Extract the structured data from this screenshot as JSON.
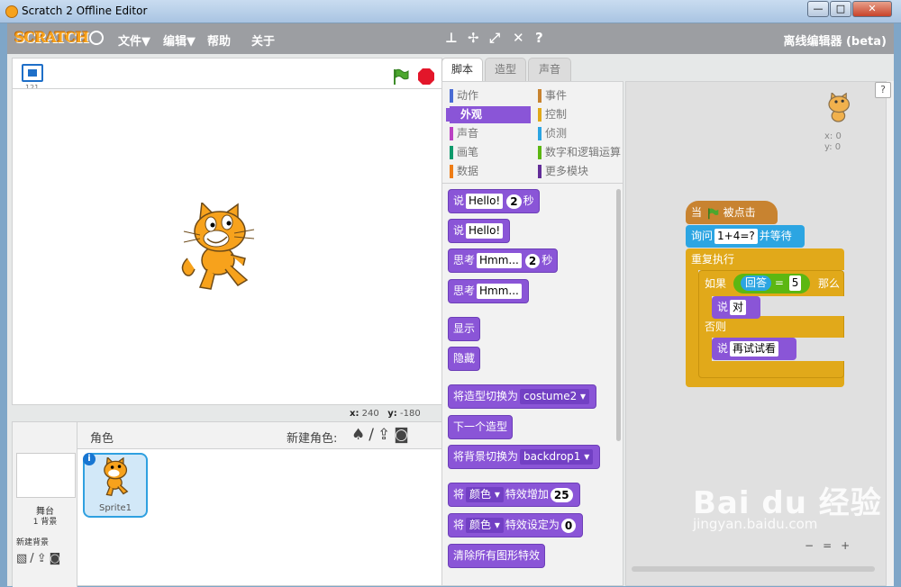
{
  "window": {
    "title": "Scratch 2 Offline Editor",
    "min": "—",
    "max": "□",
    "close": "✕"
  },
  "menu": {
    "logo": "SCRATCH",
    "file": "文件▼",
    "edit": "编辑▼",
    "help": "帮助",
    "about": "关于",
    "offline": "离线编辑器 (beta)"
  },
  "stage": {
    "version": "121",
    "x_label": "x:",
    "x_val": "240",
    "y_label": "y:",
    "y_val": "-180"
  },
  "sprites": {
    "header": "角色",
    "new_sprite": "新建角色:",
    "stage_label": "舞台",
    "backdrops": "1 背景",
    "new_backdrop": "新建背景",
    "sprite_name": "Sprite1"
  },
  "tabs": {
    "scripts": "脚本",
    "costumes": "造型",
    "sounds": "声音"
  },
  "categories": {
    "motion": "动作",
    "looks": "外观",
    "sound": "声音",
    "pen": "画笔",
    "data": "数据",
    "events": "事件",
    "control": "控制",
    "sensing": "侦测",
    "operators": "数字和逻辑运算",
    "more": "更多模块"
  },
  "blocks": {
    "say": "说",
    "hello": "Hello!",
    "secs": "秒",
    "two": "2",
    "think": "思考",
    "hmm": "Hmm...",
    "show": "显示",
    "hide": "隐藏",
    "switch_costume": "将造型切换为",
    "costume2": "costume2",
    "next_costume": "下一个造型",
    "switch_backdrop": "将背景切换为",
    "backdrop1": "backdrop1",
    "change": "将",
    "color": "颜色",
    "effect_by": "特效增加",
    "v25": "25",
    "set": "将",
    "effect_to": "特效设定为",
    "v0": "0",
    "clear": "清除所有图形特效"
  },
  "script": {
    "when": "当",
    "clicked": "被点击",
    "ask": "询问",
    "question": "1+4=?",
    "wait": "并等待",
    "forever": "重复执行",
    "if": "如果",
    "answer": "回答",
    "eq": "=",
    "five": "5",
    "then": "那么",
    "say": "说",
    "right": "对",
    "else": "否则",
    "try": "再试试看",
    "sprite_x": "x: 0",
    "sprite_y": "y: 0"
  },
  "watermark": {
    "logo": "Bai du 经验",
    "url": "jingyan.baidu.com"
  },
  "colors": {
    "looks": "#8a55d7",
    "events": "#c88330",
    "control": "#e1a91a",
    "sensing": "#2ca5e2",
    "operators": "#5cb712"
  }
}
